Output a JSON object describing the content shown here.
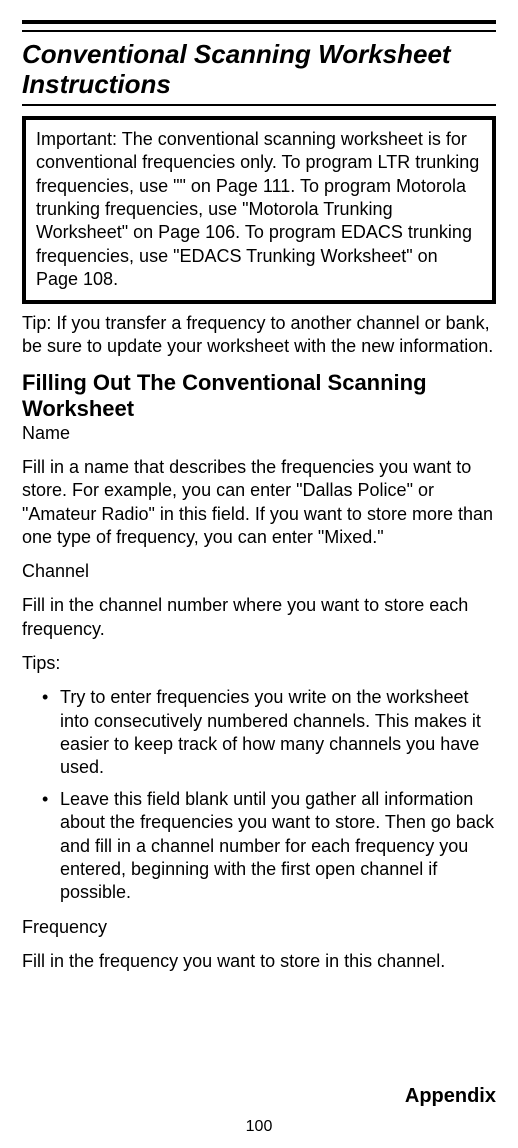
{
  "section_title": "Conventional Scanning Worksheet Instructions",
  "important_box": "Important: The conventional scanning worksheet is for conventional frequencies only.  To program LTR trunking frequencies, use \"\" on Page 111. To program Motorola trunking frequencies, use \"Motorola Trunking Worksheet\" on Page 106. To program EDACS trunking frequencies, use \"EDACS Trunking Worksheet\" on Page 108.",
  "tip_paragraph": "Tip: If you transfer a frequency to another channel or bank, be sure to update your worksheet with the new information.",
  "sub_heading": "Filling Out The Conventional Scanning Worksheet",
  "name_label": "Name",
  "name_text": "Fill in a name that describes the frequencies you want to store. For example, you can enter \"Dallas Police\" or \"Amateur Radio\" in this field. If you want to store more than one type of frequency, you can enter \"Mixed.\"",
  "channel_label": "Channel",
  "channel_text": "Fill in the channel number  where you want to store each frequency.",
  "tips_label": "Tips:",
  "tips": [
    "Try to enter frequencies you write on the worksheet into consecutively numbered channels.  This makes it easier to keep track of how many channels you have used.",
    "Leave this field blank until you gather all information about the frequencies you want to store.  Then go back and fill in a channel number for each frequency you entered, beginning with the first open channel if possible."
  ],
  "frequency_label": "Frequency",
  "frequency_text": "Fill in the frequency you want to store in this channel.",
  "appendix_label": "Appendix",
  "page_number": "100"
}
